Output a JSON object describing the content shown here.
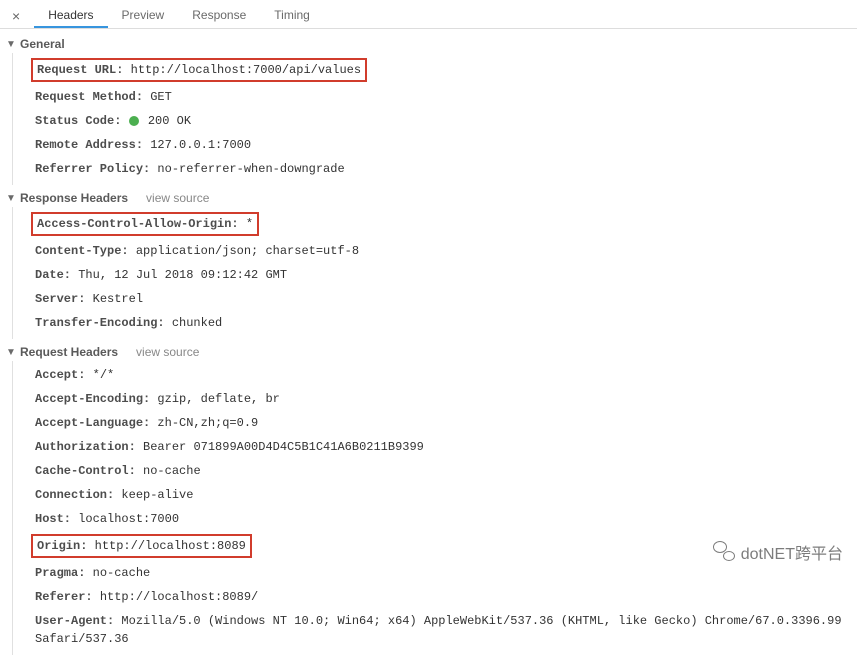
{
  "tabs": {
    "headers": "Headers",
    "preview": "Preview",
    "response": "Response",
    "timing": "Timing"
  },
  "viewSource": "view source",
  "general": {
    "title": "General",
    "requestUrlLabel": "Request URL:",
    "requestUrlValue": "http://localhost:7000/api/values",
    "requestMethodLabel": "Request Method:",
    "requestMethodValue": "GET",
    "statusCodeLabel": "Status Code:",
    "statusCodeValue": "200 OK",
    "remoteAddressLabel": "Remote Address:",
    "remoteAddressValue": "127.0.0.1:7000",
    "referrerPolicyLabel": "Referrer Policy:",
    "referrerPolicyValue": "no-referrer-when-downgrade"
  },
  "responseHeaders": {
    "title": "Response Headers",
    "acaoLabel": "Access-Control-Allow-Origin:",
    "acaoValue": "*",
    "contentTypeLabel": "Content-Type:",
    "contentTypeValue": "application/json; charset=utf-8",
    "dateLabel": "Date:",
    "dateValue": "Thu, 12 Jul 2018 09:12:42 GMT",
    "serverLabel": "Server:",
    "serverValue": "Kestrel",
    "transferEncodingLabel": "Transfer-Encoding:",
    "transferEncodingValue": "chunked"
  },
  "requestHeaders": {
    "title": "Request Headers",
    "acceptLabel": "Accept:",
    "acceptValue": "*/*",
    "acceptEncodingLabel": "Accept-Encoding:",
    "acceptEncodingValue": "gzip, deflate, br",
    "acceptLanguageLabel": "Accept-Language:",
    "acceptLanguageValue": "zh-CN,zh;q=0.9",
    "authorizationLabel": "Authorization:",
    "authorizationValue": "Bearer 071899A00D4D4C5B1C41A6B0211B9399",
    "cacheControlLabel": "Cache-Control:",
    "cacheControlValue": "no-cache",
    "connectionLabel": "Connection:",
    "connectionValue": "keep-alive",
    "hostLabel": "Host:",
    "hostValue": "localhost:7000",
    "originLabel": "Origin:",
    "originValue": "http://localhost:8089",
    "pragmaLabel": "Pragma:",
    "pragmaValue": "no-cache",
    "refererLabel": "Referer:",
    "refererValue": "http://localhost:8089/",
    "userAgentLabel": "User-Agent:",
    "userAgentValue": "Mozilla/5.0 (Windows NT 10.0; Win64; x64) AppleWebKit/537.36 (KHTML, like Gecko) Chrome/67.0.3396.99 Safari/537.36"
  },
  "watermark": "dotNET跨平台"
}
